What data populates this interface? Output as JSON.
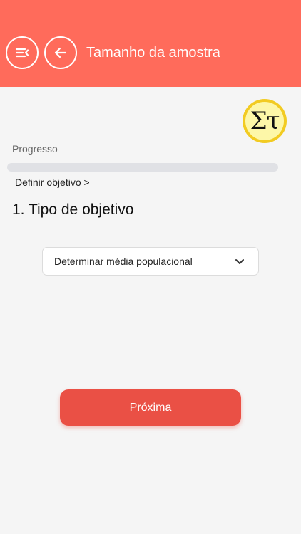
{
  "header": {
    "title": "Tamanho da amostra",
    "menu_icon": "menu-collapse-icon",
    "back_icon": "arrow-left-icon",
    "color": "#ff6b5b"
  },
  "logo": {
    "text": "Στ",
    "icon": "sigma-tau-logo"
  },
  "progress": {
    "label": "Progresso",
    "value": 0
  },
  "breadcrumb": "Definir objetivo >",
  "section": {
    "title": "1. Tipo de objetivo"
  },
  "objective_select": {
    "value": "Determinar média populacional",
    "icon": "chevron-down-icon"
  },
  "next_button": {
    "label": "Próxima",
    "color": "#ea5045"
  }
}
